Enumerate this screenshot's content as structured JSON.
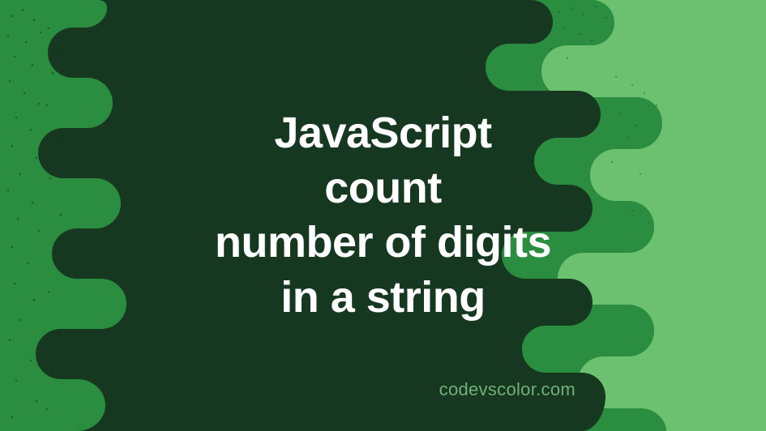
{
  "title": {
    "line1": "JavaScript",
    "line2": "count",
    "line3": "number of digits",
    "line4": "in a string"
  },
  "watermark": "codevscolor.com",
  "colors": {
    "bg_darkest": "#18381e",
    "bg_dark": "#173820",
    "bg_medium": "#2a8d3f",
    "bg_light": "#6cc170",
    "text": "#ffffff",
    "watermark": "#6fb07a"
  }
}
